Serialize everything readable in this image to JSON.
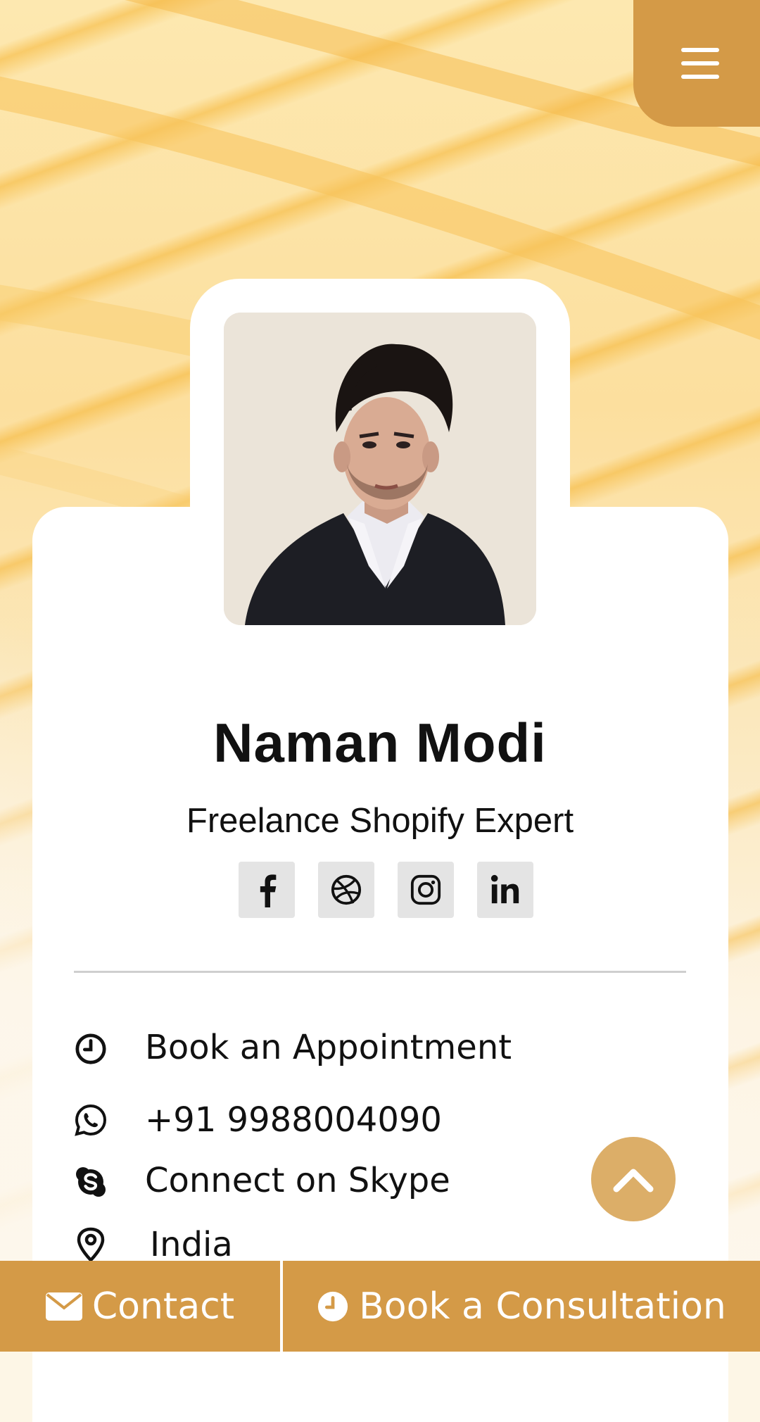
{
  "profile": {
    "name": "Naman Modi",
    "title": "Freelance Shopify Expert"
  },
  "socials": [
    {
      "icon": "facebook-icon"
    },
    {
      "icon": "dribbble-icon"
    },
    {
      "icon": "instagram-icon"
    },
    {
      "icon": "linkedin-icon"
    }
  ],
  "info": {
    "appointment": "Book an Appointment",
    "phone": "+91 9988004090",
    "skype": "Connect on Skype",
    "location": "India"
  },
  "bottom": {
    "contact_label": "Contact",
    "consult_label": "Book a Consultation"
  },
  "colors": {
    "accent": "#d49a47",
    "fab": "#dcae68",
    "background": "#fde8b0"
  }
}
